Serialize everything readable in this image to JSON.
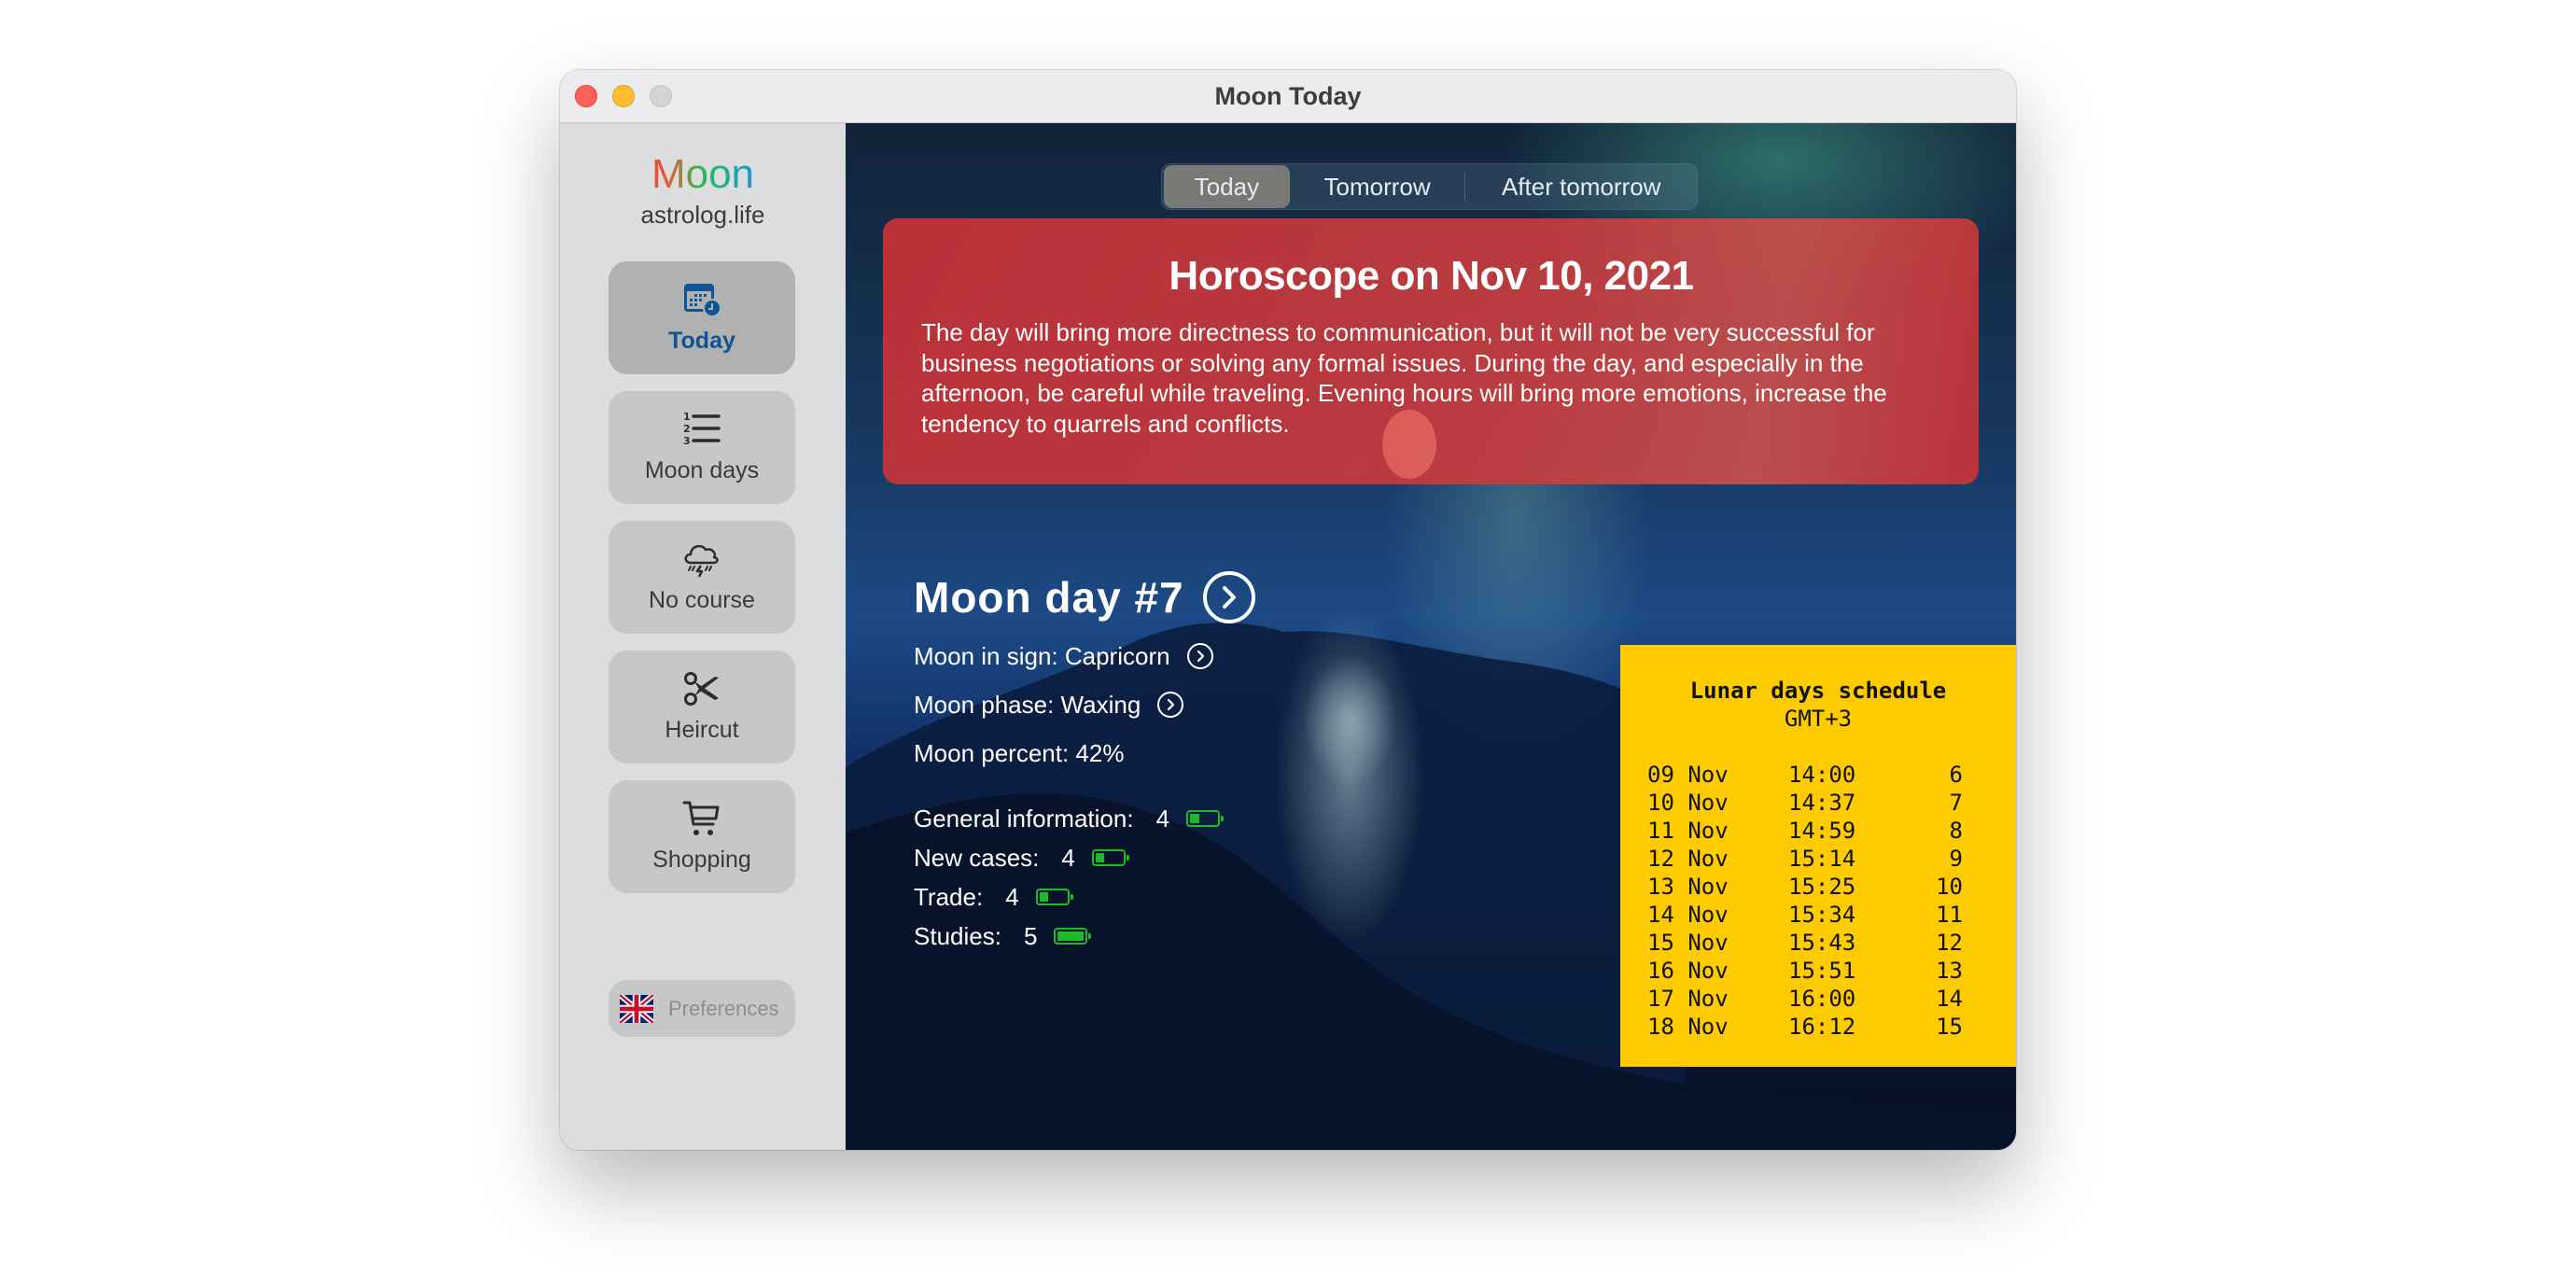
{
  "window": {
    "title": "Moon Today",
    "controls": [
      "close",
      "minimize",
      "zoom"
    ]
  },
  "sidebar": {
    "brand": {
      "name": "Moon",
      "site": "astrolog.life"
    },
    "items": [
      {
        "label": "Today",
        "icon": "calendar-clock-icon",
        "active": true
      },
      {
        "label": "Moon days",
        "icon": "numbered-list-icon",
        "active": false
      },
      {
        "label": "No course",
        "icon": "thunderstorm-cloud-icon",
        "active": false
      },
      {
        "label": "Heircut",
        "icon": "scissors-icon",
        "active": false
      },
      {
        "label": "Shopping",
        "icon": "shopping-cart-icon",
        "active": false
      }
    ],
    "preferences": {
      "label": "Preferences",
      "icon": "uk-flag-icon"
    }
  },
  "tabs": [
    {
      "label": "Today",
      "active": true
    },
    {
      "label": "Tomorrow",
      "active": false
    },
    {
      "label": "After tomorrow",
      "active": false
    }
  ],
  "horoscope": {
    "title": "Horoscope on Nov 10, 2021",
    "text": "The day will bring more directness to communication, but it will not be very successful for business negotiations or solving any formal issues. During the day, and especially in the afternoon, be careful while traveling. Evening hours will bring more emotions, increase the tendency to quarrels and conflicts."
  },
  "moon_day": {
    "title": "Moon day #7",
    "sign": "Moon in sign: Capricorn",
    "phase": "Moon phase: Waxing",
    "percent": "Moon percent: 42%"
  },
  "ratings": [
    {
      "label": "General information:",
      "value": "4",
      "level": 0.3
    },
    {
      "label": "New cases:",
      "value": "4",
      "level": 0.3
    },
    {
      "label": "Trade:",
      "value": "4",
      "level": 0.3
    },
    {
      "label": "Studies:",
      "value": "5",
      "level": 1.0
    }
  ],
  "schedule": {
    "title": "Lunar days schedule",
    "timezone": "GMT+3",
    "rows": [
      {
        "date": "09 Nov",
        "time": "14:00",
        "day": "6"
      },
      {
        "date": "10 Nov",
        "time": "14:37",
        "day": "7"
      },
      {
        "date": "11 Nov",
        "time": "14:59",
        "day": "8"
      },
      {
        "date": "12 Nov",
        "time": "15:14",
        "day": "9"
      },
      {
        "date": "13 Nov",
        "time": "15:25",
        "day": "10"
      },
      {
        "date": "14 Nov",
        "time": "15:34",
        "day": "11"
      },
      {
        "date": "15 Nov",
        "time": "15:43",
        "day": "12"
      },
      {
        "date": "16 Nov",
        "time": "15:51",
        "day": "13"
      },
      {
        "date": "17 Nov",
        "time": "16:00",
        "day": "14"
      },
      {
        "date": "18 Nov",
        "time": "16:12",
        "day": "15"
      }
    ]
  },
  "colors": {
    "accent": "#0f5494",
    "horoscope_card": "#c4343a",
    "schedule_bg": "#fecb00",
    "battery": "#1fba2a"
  }
}
